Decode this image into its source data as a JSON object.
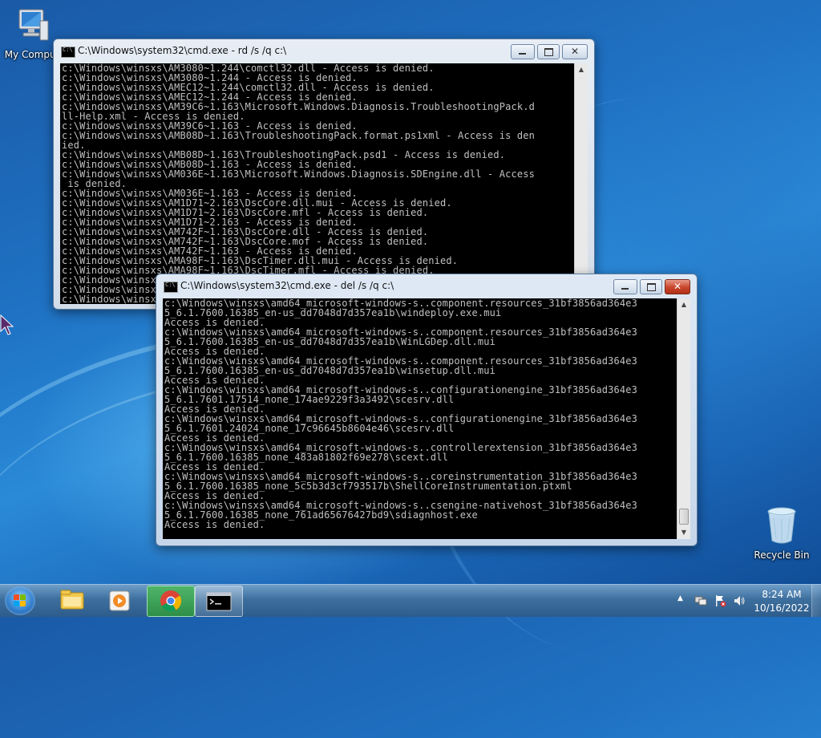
{
  "desktop": {
    "icons": {
      "my_computer": "My Comput",
      "recycle_bin": "Recycle Bin"
    }
  },
  "windows": {
    "rd": {
      "title": "C:\\Windows\\system32\\cmd.exe - rd  /s /q c:\\",
      "output": "c:\\Windows\\winsxs\\AM3080~1.244\\comctl32.dll - Access is denied.\nc:\\Windows\\winsxs\\AM3080~1.244 - Access is denied.\nc:\\Windows\\winsxs\\AMEC12~1.244\\comctl32.dll - Access is denied.\nc:\\Windows\\winsxs\\AMEC12~1.244 - Access is denied.\nc:\\Windows\\winsxs\\AM39C6~1.163\\Microsoft.Windows.Diagnosis.TroubleshootingPack.d\nll-Help.xml - Access is denied.\nc:\\Windows\\winsxs\\AM39C6~1.163 - Access is denied.\nc:\\Windows\\winsxs\\AMB08D~1.163\\TroubleshootingPack.format.ps1xml - Access is den\nied.\nc:\\Windows\\winsxs\\AMB08D~1.163\\TroubleshootingPack.psd1 - Access is denied.\nc:\\Windows\\winsxs\\AMB08D~1.163 - Access is denied.\nc:\\Windows\\winsxs\\AM036E~1.163\\Microsoft.Windows.Diagnosis.SDEngine.dll - Access\n is denied.\nc:\\Windows\\winsxs\\AM036E~1.163 - Access is denied.\nc:\\Windows\\winsxs\\AM1D71~2.163\\DscCore.dll.mui - Access is denied.\nc:\\Windows\\winsxs\\AM1D71~2.163\\DscCore.mfl - Access is denied.\nc:\\Windows\\winsxs\\AM1D71~2.163 - Access is denied.\nc:\\Windows\\winsxs\\AM742F~1.163\\DscCore.dll - Access is denied.\nc:\\Windows\\winsxs\\AM742F~1.163\\DscCore.mof - Access is denied.\nc:\\Windows\\winsxs\\AM742F~1.163 - Access is denied.\nc:\\Windows\\winsxs\\AMA98F~1.163\\DscTimer.dll.mui - Access is denied.\nc:\\Windows\\winsxs\\AMA98F~1.163\\DscTimer.mfl - Access is denied.\nc:\\Windows\\winsxs\\AMA98F~1.163 - Access is denied.\nc:\\Windows\\winsxs\\AMA98F~1.163\\DscTimer.mof - Access is denied.\nc:\\Windows\\winsxs\\AMA98F~1.163 - Access is denied."
    },
    "del": {
      "title": "C:\\Windows\\system32\\cmd.exe - del  /s /q c:\\",
      "output": "c:\\Windows\\winsxs\\amd64_microsoft-windows-s..component.resources_31bf3856ad364e3\n5_6.1.7600.16385_en-us_dd7048d7d357ea1b\\windeploy.exe.mui\nAccess is denied.\nc:\\Windows\\winsxs\\amd64_microsoft-windows-s..component.resources_31bf3856ad364e3\n5_6.1.7600.16385_en-us_dd7048d7d357ea1b\\WinLGDep.dll.mui\nAccess is denied.\nc:\\Windows\\winsxs\\amd64_microsoft-windows-s..component.resources_31bf3856ad364e3\n5_6.1.7600.16385_en-us_dd7048d7d357ea1b\\winsetup.dll.mui\nAccess is denied.\nc:\\Windows\\winsxs\\amd64_microsoft-windows-s..configurationengine_31bf3856ad364e3\n5_6.1.7601.17514_none_174ae9229f3a3492\\scesrv.dll\nAccess is denied.\nc:\\Windows\\winsxs\\amd64_microsoft-windows-s..configurationengine_31bf3856ad364e3\n5_6.1.7601.24024_none_17c96645b8604e46\\scesrv.dll\nAccess is denied.\nc:\\Windows\\winsxs\\amd64_microsoft-windows-s..controllerextension_31bf3856ad364e3\n5_6.1.7600.16385_none_483a81802f69e278\\scext.dll\nAccess is denied.\nc:\\Windows\\winsxs\\amd64_microsoft-windows-s..coreinstrumentation_31bf3856ad364e3\n5_6.1.7600.16385_none_5c5b3d3cf793517b\\ShellCoreInstrumentation.ptxml\nAccess is denied.\nc:\\Windows\\winsxs\\amd64_microsoft-windows-s..csengine-nativehost_31bf3856ad364e3\n5_6.1.7600.16385_none_761ad65676427bd9\\sdiagnhost.exe\nAccess is denied."
    }
  },
  "taskbar": {
    "clock_time": "8:24 AM",
    "clock_date": "10/16/2022"
  },
  "colors": {
    "console_bg": "#000000",
    "console_text": "#c0c0c0",
    "close_red": "#c8442b"
  }
}
